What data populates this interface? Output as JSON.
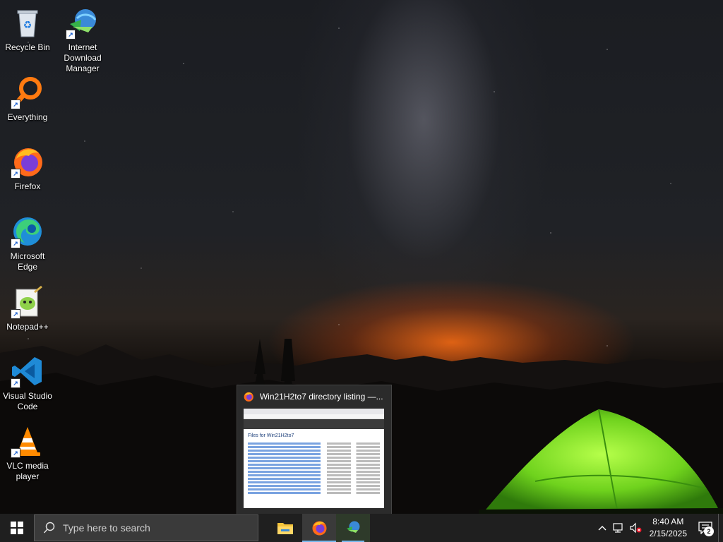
{
  "desktop": {
    "icons": [
      {
        "label": "Recycle Bin",
        "icon": "recycle-bin-icon"
      },
      {
        "label": "Internet Download Manager",
        "icon": "idm-icon"
      },
      {
        "label": "Everything",
        "icon": "everything-icon"
      },
      {
        "label": "Firefox",
        "icon": "firefox-icon"
      },
      {
        "label": "Microsoft Edge",
        "icon": "edge-icon"
      },
      {
        "label": "Notepad++",
        "icon": "notepadpp-icon"
      },
      {
        "label": "Visual Studio Code",
        "icon": "vscode-icon"
      },
      {
        "label": "VLC media player",
        "icon": "vlc-icon"
      }
    ]
  },
  "preview": {
    "title": "Win21H2to7 directory listing —...",
    "page_heading": "Files for Win21H2to7"
  },
  "taskbar": {
    "search_placeholder": "Type here to search",
    "apps": [
      {
        "name": "File Explorer",
        "icon": "folder-icon"
      },
      {
        "name": "Firefox",
        "icon": "firefox-icon"
      },
      {
        "name": "Internet Download Manager",
        "icon": "idm-icon"
      }
    ],
    "clock": {
      "time": "8:40 AM",
      "date": "2/15/2025"
    },
    "notification_count": "2"
  },
  "colors": {
    "accent": "#76b9ed",
    "taskbar": "#1f1f1f",
    "tent": "#7ee82a"
  }
}
